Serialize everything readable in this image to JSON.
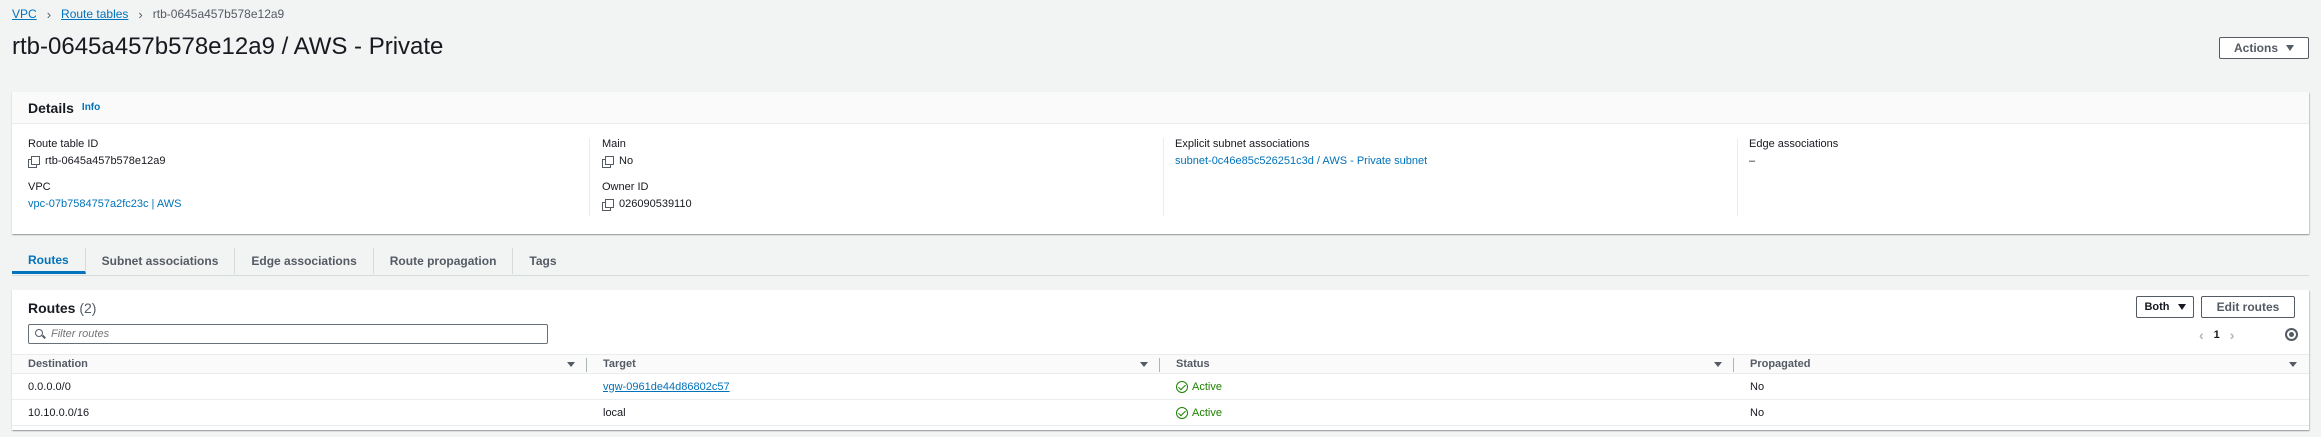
{
  "breadcrumb": {
    "vpc": "VPC",
    "route_tables": "Route tables",
    "current": "rtb-0645a457b578e12a9"
  },
  "page": {
    "title": "rtb-0645a457b578e12a9 / AWS - Private",
    "actions_label": "Actions"
  },
  "details": {
    "title": "Details",
    "info": "Info",
    "route_table_id_label": "Route table ID",
    "route_table_id": "rtb-0645a457b578e12a9",
    "vpc_label": "VPC",
    "vpc": "vpc-07b7584757a2fc23c | AWS",
    "main_label": "Main",
    "main": "No",
    "owner_id_label": "Owner ID",
    "owner_id": "026090539110",
    "explicit_label": "Explicit subnet associations",
    "explicit": "subnet-0c46e85c526251c3d / AWS - Private subnet",
    "edge_label": "Edge associations",
    "edge": "–"
  },
  "tabs": [
    "Routes",
    "Subnet associations",
    "Edge associations",
    "Route propagation",
    "Tags"
  ],
  "routes": {
    "title": "Routes",
    "count": "(2)",
    "filter_placeholder": "Filter routes",
    "both_label": "Both",
    "edit_label": "Edit routes",
    "page": "1",
    "columns": [
      "Destination",
      "Target",
      "Status",
      "Propagated"
    ],
    "rows": [
      {
        "destination": "0.0.0.0/0",
        "target": "vgw-0961de44d86802c57",
        "status": "Active",
        "propagated": "No"
      },
      {
        "destination": "10.10.0.0/16",
        "target": "local",
        "status": "Active",
        "propagated": "No"
      }
    ]
  },
  "colors": {
    "link": "#0073bb",
    "active_status": "#1d8102"
  }
}
